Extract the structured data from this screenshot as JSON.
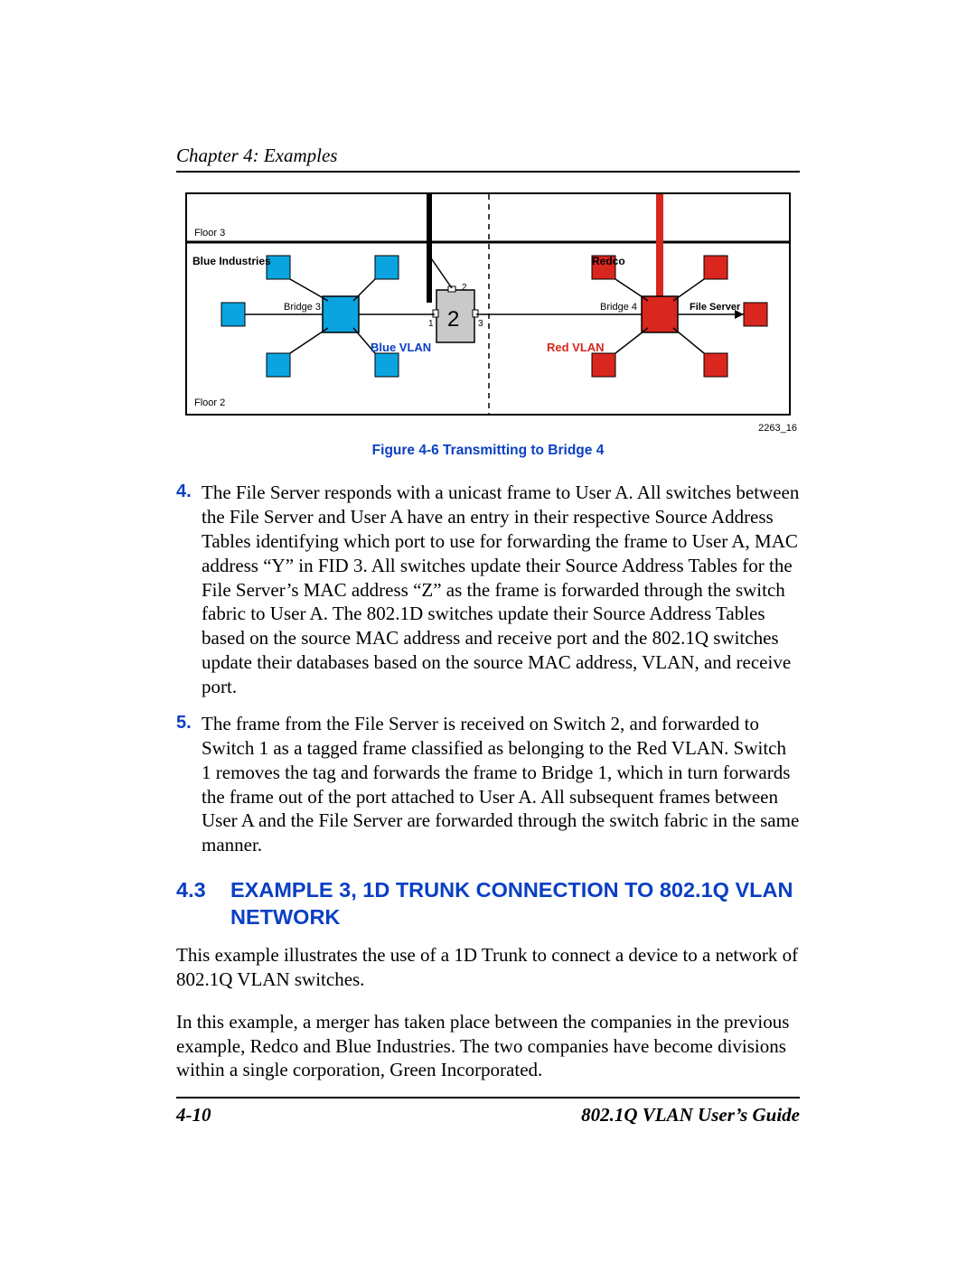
{
  "header": "Chapter 4: Examples",
  "figure": {
    "floor3": "Floor 3",
    "floor2": "Floor 2",
    "blueIndustries": "Blue Industries",
    "redco": "Redco",
    "bridge3": "Bridge 3",
    "bridge4": "Bridge 4",
    "fileServer": "File Server",
    "blueVlan": "Blue VLAN",
    "redVlan": "Red VLAN",
    "switchNum": "2",
    "p1": "1",
    "p2": "2",
    "p3": "3",
    "figId": "2263_16",
    "caption": "Figure 4-6    Transmitting to Bridge 4"
  },
  "list": {
    "item4": {
      "num": "4.",
      "text": "The File Server responds with a unicast frame to User A. All switches between the File Server and User A have an entry in their respective Source Address Tables identifying which port to use for forwarding the frame to User A, MAC address “Y” in FID 3. All switches update their Source Address Tables for the File Server’s MAC address “Z” as the frame is forwarded through the switch fabric to User A. The 802.1D switches update their Source Address Tables based on the source MAC address and receive port and the 802.1Q switches update their databases based on the source MAC address, VLAN, and receive port."
    },
    "item5": {
      "num": "5.",
      "text": "The frame from the File Server is received on Switch 2, and forwarded to Switch 1 as a tagged frame classified as belonging to the Red VLAN. Switch 1 removes the tag and forwards the frame to Bridge 1, which in turn forwards the frame out of the port attached to User A. All subsequent frames between User A and the File Server are forwarded through the switch fabric in the same manner."
    }
  },
  "section": {
    "num": "4.3",
    "title": "EXAMPLE 3, 1D TRUNK CONNECTION TO 802.1Q VLAN NETWORK"
  },
  "para1": "This example illustrates the use of a 1D Trunk to connect a device to a network of 802.1Q VLAN switches.",
  "para2": "In this example, a merger has taken place between the companies in the previous example, Redco and Blue Industries. The two companies have become divisions within a single corporation, Green Incorporated.",
  "footer": {
    "pageNum": "4-10",
    "guide": "802.1Q VLAN User’s Guide"
  }
}
